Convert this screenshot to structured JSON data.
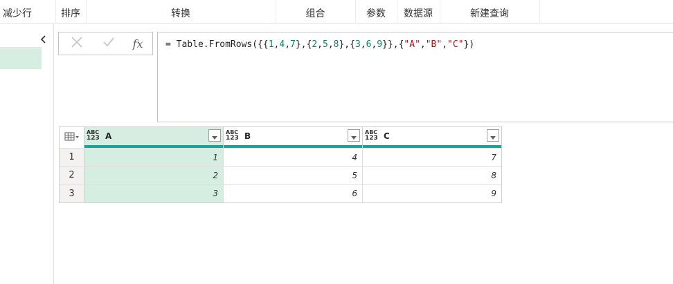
{
  "ribbon": {
    "groups": [
      "减少行",
      "排序",
      "转换",
      "组合",
      "参数",
      "数据源",
      "新建查询"
    ]
  },
  "icons": {
    "collapse": "chevron-left-icon",
    "cancel": "x-icon",
    "commit": "check-icon",
    "fx": "fx-icon",
    "table": "table-icon",
    "dropdown": "chevron-down-icon"
  },
  "formula_bar": {
    "fx_label": "fx",
    "formula": "= Table.FromRows({{1,4,7},{2,5,8},{3,6,9}},{\"A\",\"B\",\"C\"})"
  },
  "table": {
    "type_label_top": "ABC",
    "type_label_bottom": "123",
    "columns": [
      "A",
      "B",
      "C"
    ],
    "rows": [
      {
        "num": "1",
        "cells": [
          "1",
          "4",
          "7"
        ]
      },
      {
        "num": "2",
        "cells": [
          "2",
          "5",
          "8"
        ]
      },
      {
        "num": "3",
        "cells": [
          "3",
          "6",
          "9"
        ]
      }
    ]
  },
  "colors": {
    "selected_column": "#d5eee1",
    "quality_bar": "#17a596",
    "number_literal": "#098658",
    "string_literal": "#a31515"
  }
}
